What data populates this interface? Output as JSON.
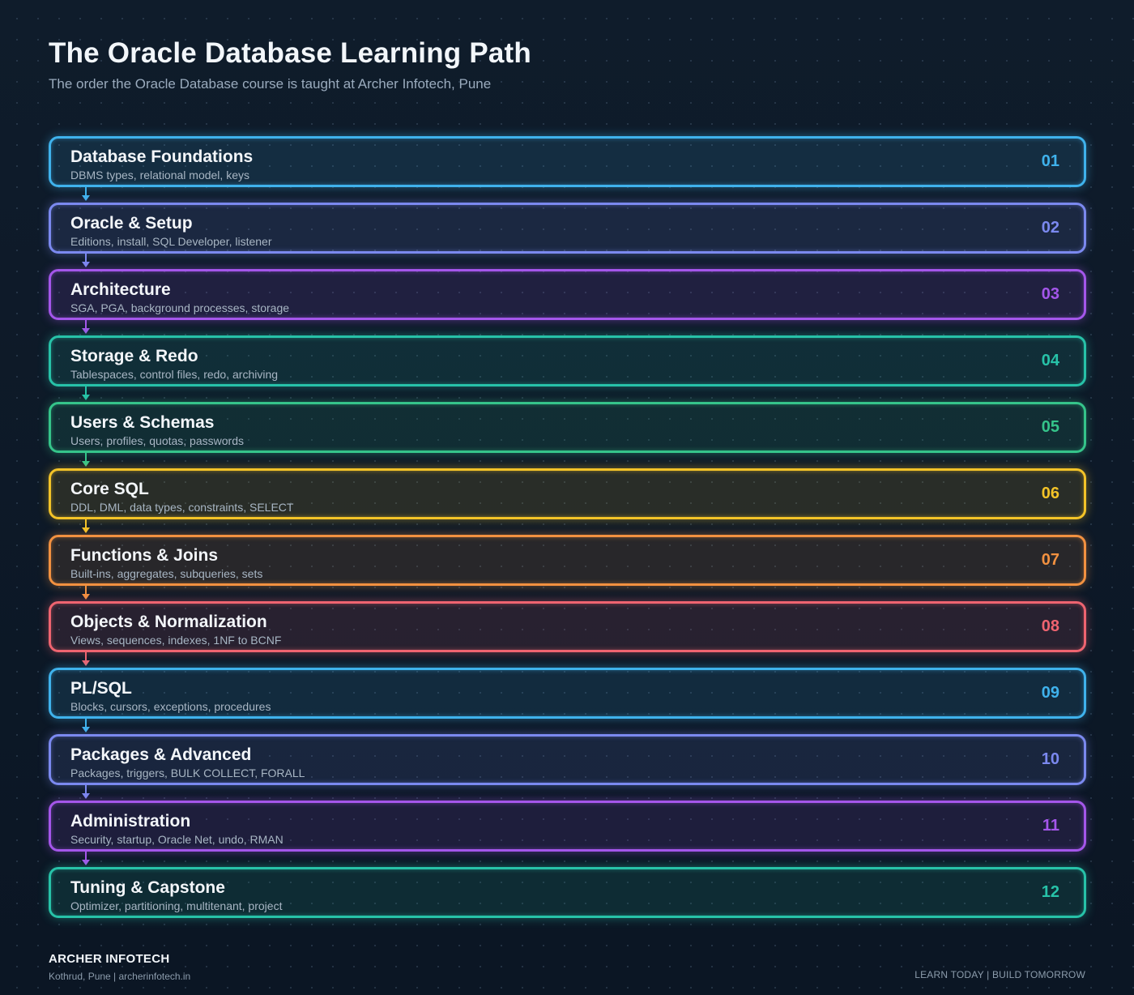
{
  "header": {
    "title": "The Oracle Database Learning Path",
    "subtitle": "The order the Oracle Database course is taught at Archer Infotech, Pune"
  },
  "steps": [
    {
      "title": "Database Foundations",
      "desc": "DBMS types, relational model, keys",
      "num": "01",
      "color": "#3fb2ec"
    },
    {
      "title": "Oracle & Setup",
      "desc": "Editions, install, SQL Developer, listener",
      "num": "02",
      "color": "#7b89ef"
    },
    {
      "title": "Architecture",
      "desc": "SGA, PGA, background processes, storage",
      "num": "03",
      "color": "#a456ea"
    },
    {
      "title": "Storage & Redo",
      "desc": "Tablespaces, control files, redo, archiving",
      "num": "04",
      "color": "#27c2a8"
    },
    {
      "title": "Users & Schemas",
      "desc": "Users, profiles, quotas, passwords",
      "num": "05",
      "color": "#35c48a"
    },
    {
      "title": "Core SQL",
      "desc": "DDL, DML, data types, constraints, SELECT",
      "num": "06",
      "color": "#f3c328"
    },
    {
      "title": "Functions & Joins",
      "desc": "Built-ins, aggregates, subqueries, sets",
      "num": "07",
      "color": "#f29140"
    },
    {
      "title": "Objects & Normalization",
      "desc": "Views, sequences, indexes, 1NF to BCNF",
      "num": "08",
      "color": "#ef6470"
    },
    {
      "title": "PL/SQL",
      "desc": "Blocks, cursors, exceptions, procedures",
      "num": "09",
      "color": "#3fb2ec"
    },
    {
      "title": "Packages & Advanced",
      "desc": "Packages, triggers, BULK COLLECT, FORALL",
      "num": "10",
      "color": "#7b89ef"
    },
    {
      "title": "Administration",
      "desc": "Security, startup, Oracle Net, undo, RMAN",
      "num": "11",
      "color": "#a456ea"
    },
    {
      "title": "Tuning & Capstone",
      "desc": "Optimizer, partitioning, multitenant, project",
      "num": "12",
      "color": "#27c2a8"
    }
  ],
  "footer": {
    "brand": "ARCHER INFOTECH",
    "contact": "Kothrud, Pune  |  archerinfotech.in",
    "tagline": "LEARN TODAY  |  BUILD TOMORROW"
  }
}
